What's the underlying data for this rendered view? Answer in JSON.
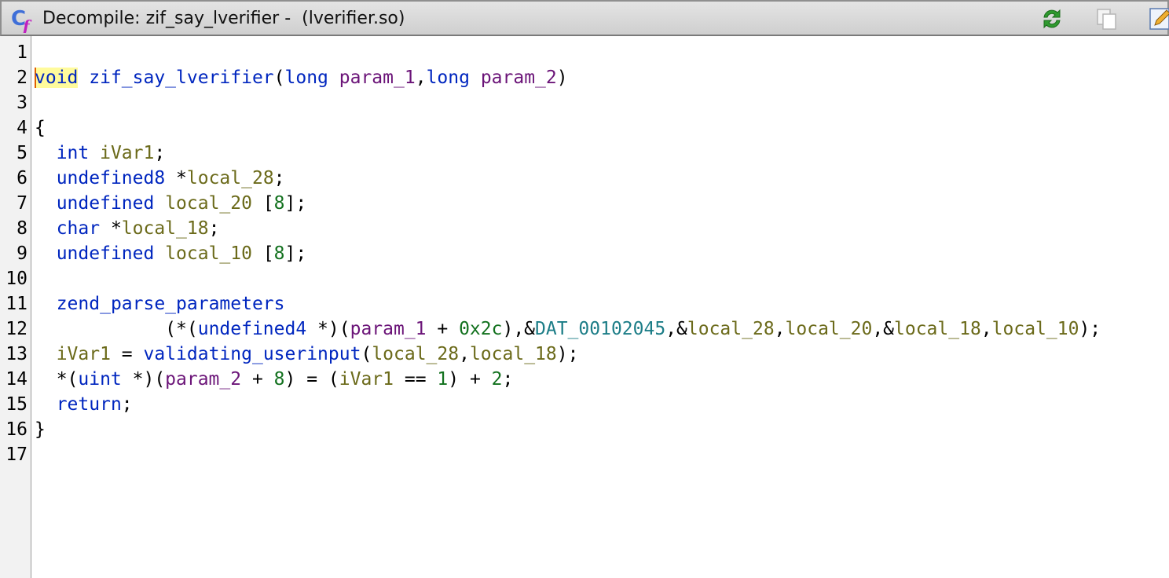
{
  "window": {
    "title": "Decompile: zif_say_lverifier -  (lverifier.so)",
    "icon": "decompiler-cf-icon",
    "toolbar": [
      {
        "name": "refresh-button",
        "icon": "refresh-icon"
      },
      {
        "name": "copy-button",
        "icon": "copy-icon"
      },
      {
        "name": "edit-button",
        "icon": "edit-icon"
      }
    ]
  },
  "colors": {
    "keyword": "#0026bf",
    "function": "#0026bf",
    "parameter": "#6b1478",
    "local_variable": "#6b6a1a",
    "number": "#12711e",
    "global": "#1c7d87",
    "highlight": "#fffb9c"
  },
  "code": {
    "lines": [
      {
        "n": "1",
        "tokens": []
      },
      {
        "n": "2",
        "tokens": [
          {
            "t": "void",
            "k": "kw hl"
          },
          {
            "t": " ",
            "k": "plain"
          },
          {
            "t": "zif_say_lverifier",
            "k": "fn"
          },
          {
            "t": "(",
            "k": "plain"
          },
          {
            "t": "long",
            "k": "kw"
          },
          {
            "t": " ",
            "k": "plain"
          },
          {
            "t": "param_1",
            "k": "par"
          },
          {
            "t": ",",
            "k": "plain"
          },
          {
            "t": "long",
            "k": "kw"
          },
          {
            "t": " ",
            "k": "plain"
          },
          {
            "t": "param_2",
            "k": "par"
          },
          {
            "t": ")",
            "k": "plain"
          }
        ]
      },
      {
        "n": "3",
        "tokens": []
      },
      {
        "n": "4",
        "tokens": [
          {
            "t": "{",
            "k": "plain"
          }
        ]
      },
      {
        "n": "5",
        "tokens": [
          {
            "t": "  ",
            "k": "plain"
          },
          {
            "t": "int",
            "k": "kw"
          },
          {
            "t": " ",
            "k": "plain"
          },
          {
            "t": "iVar1",
            "k": "var"
          },
          {
            "t": ";",
            "k": "plain"
          }
        ]
      },
      {
        "n": "6",
        "tokens": [
          {
            "t": "  ",
            "k": "plain"
          },
          {
            "t": "undefined8",
            "k": "kw"
          },
          {
            "t": " *",
            "k": "plain"
          },
          {
            "t": "local_28",
            "k": "var"
          },
          {
            "t": ";",
            "k": "plain"
          }
        ]
      },
      {
        "n": "7",
        "tokens": [
          {
            "t": "  ",
            "k": "plain"
          },
          {
            "t": "undefined",
            "k": "kw"
          },
          {
            "t": " ",
            "k": "plain"
          },
          {
            "t": "local_20",
            "k": "var"
          },
          {
            "t": " [",
            "k": "plain"
          },
          {
            "t": "8",
            "k": "num"
          },
          {
            "t": "];",
            "k": "plain"
          }
        ]
      },
      {
        "n": "8",
        "tokens": [
          {
            "t": "  ",
            "k": "plain"
          },
          {
            "t": "char",
            "k": "kw"
          },
          {
            "t": " *",
            "k": "plain"
          },
          {
            "t": "local_18",
            "k": "var"
          },
          {
            "t": ";",
            "k": "plain"
          }
        ]
      },
      {
        "n": "9",
        "tokens": [
          {
            "t": "  ",
            "k": "plain"
          },
          {
            "t": "undefined",
            "k": "kw"
          },
          {
            "t": " ",
            "k": "plain"
          },
          {
            "t": "local_10",
            "k": "var"
          },
          {
            "t": " [",
            "k": "plain"
          },
          {
            "t": "8",
            "k": "num"
          },
          {
            "t": "];",
            "k": "plain"
          }
        ]
      },
      {
        "n": "10",
        "tokens": []
      },
      {
        "n": "11",
        "tokens": [
          {
            "t": "  ",
            "k": "plain"
          },
          {
            "t": "zend_parse_parameters",
            "k": "fn"
          }
        ]
      },
      {
        "n": "12",
        "tokens": [
          {
            "t": "            (*(",
            "k": "plain"
          },
          {
            "t": "undefined4",
            "k": "kw"
          },
          {
            "t": " *)(",
            "k": "plain"
          },
          {
            "t": "param_1",
            "k": "par"
          },
          {
            "t": " + ",
            "k": "plain"
          },
          {
            "t": "0x2c",
            "k": "num"
          },
          {
            "t": "),&",
            "k": "plain"
          },
          {
            "t": "DAT_00102045",
            "k": "glob"
          },
          {
            "t": ",&",
            "k": "plain"
          },
          {
            "t": "local_28",
            "k": "var"
          },
          {
            "t": ",",
            "k": "plain"
          },
          {
            "t": "local_20",
            "k": "var"
          },
          {
            "t": ",&",
            "k": "plain"
          },
          {
            "t": "local_18",
            "k": "var"
          },
          {
            "t": ",",
            "k": "plain"
          },
          {
            "t": "local_10",
            "k": "var"
          },
          {
            "t": ");",
            "k": "plain"
          }
        ]
      },
      {
        "n": "13",
        "tokens": [
          {
            "t": "  ",
            "k": "plain"
          },
          {
            "t": "iVar1",
            "k": "var"
          },
          {
            "t": " = ",
            "k": "plain"
          },
          {
            "t": "validating_userinput",
            "k": "fn"
          },
          {
            "t": "(",
            "k": "plain"
          },
          {
            "t": "local_28",
            "k": "var"
          },
          {
            "t": ",",
            "k": "plain"
          },
          {
            "t": "local_18",
            "k": "var"
          },
          {
            "t": ");",
            "k": "plain"
          }
        ]
      },
      {
        "n": "14",
        "tokens": [
          {
            "t": "  *(",
            "k": "plain"
          },
          {
            "t": "uint",
            "k": "kw"
          },
          {
            "t": " *)(",
            "k": "plain"
          },
          {
            "t": "param_2",
            "k": "par"
          },
          {
            "t": " + ",
            "k": "plain"
          },
          {
            "t": "8",
            "k": "num"
          },
          {
            "t": ") = (",
            "k": "plain"
          },
          {
            "t": "iVar1",
            "k": "var"
          },
          {
            "t": " == ",
            "k": "plain"
          },
          {
            "t": "1",
            "k": "num"
          },
          {
            "t": ") + ",
            "k": "plain"
          },
          {
            "t": "2",
            "k": "num"
          },
          {
            "t": ";",
            "k": "plain"
          }
        ]
      },
      {
        "n": "15",
        "tokens": [
          {
            "t": "  ",
            "k": "plain"
          },
          {
            "t": "return",
            "k": "kw"
          },
          {
            "t": ";",
            "k": "plain"
          }
        ]
      },
      {
        "n": "16",
        "tokens": [
          {
            "t": "}",
            "k": "plain"
          }
        ]
      },
      {
        "n": "17",
        "tokens": []
      }
    ]
  }
}
